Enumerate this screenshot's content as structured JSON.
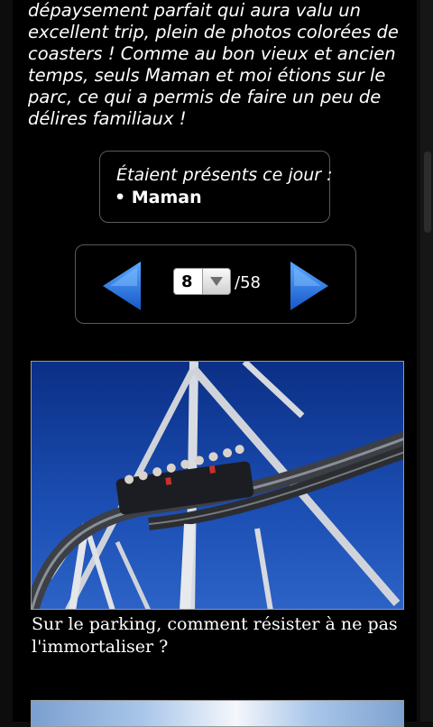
{
  "story": {
    "intro_text": "dépaysement parfait qui aura valu un excellent trip, plein de photos colorées de coasters ! Comme au bon vieux et ancien temps, seuls Maman et moi étions sur le parc, ce qui a permis de faire un peu de délires familiaux !"
  },
  "attendance": {
    "title": "Étaient présents ce jour :",
    "people": [
      "• Maman"
    ]
  },
  "pager": {
    "current_page": "8",
    "total_label": "/58",
    "prev_icon": "left-arrow-icon",
    "next_icon": "right-arrow-icon"
  },
  "photos": [
    {
      "caption": "Sur le parking, comment résister à ne pas l'immortaliser ?"
    }
  ],
  "colors": {
    "arrow_blue": "#1e6fe0",
    "background": "#000000",
    "box_border": "#5a5a5a"
  }
}
